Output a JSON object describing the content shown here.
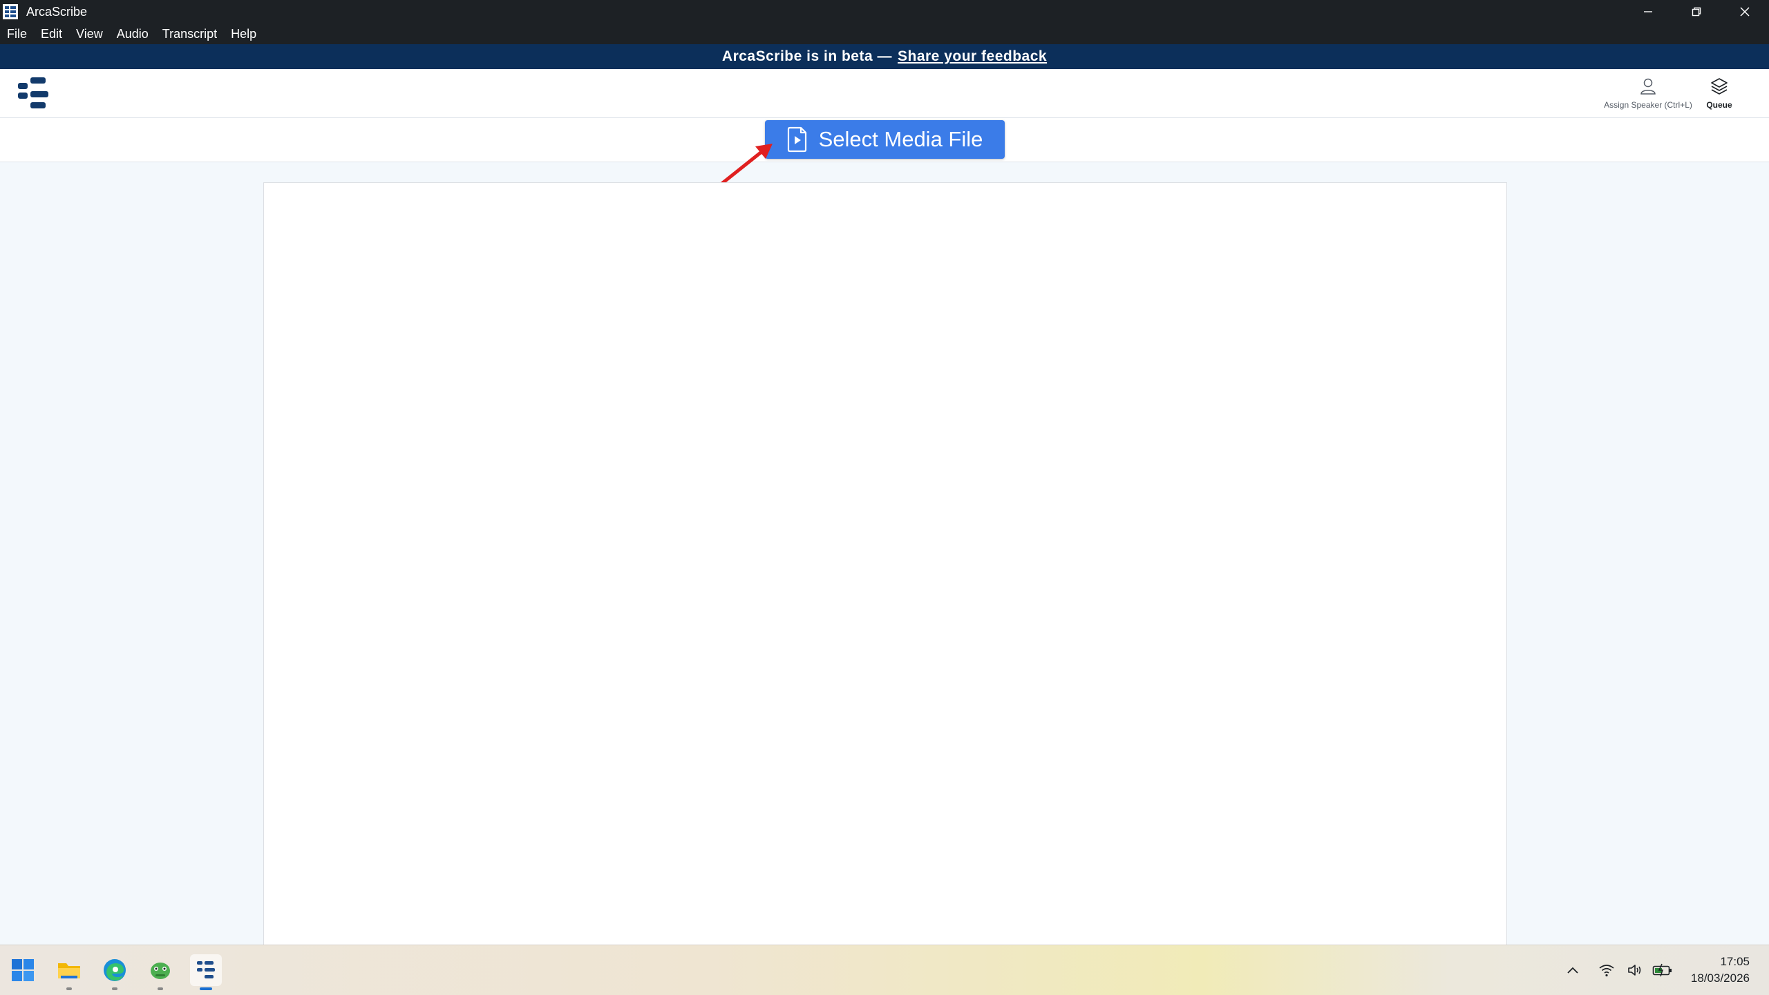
{
  "window": {
    "title": "ArcaScribe"
  },
  "menu": {
    "items": [
      "File",
      "Edit",
      "View",
      "Audio",
      "Transcript",
      "Help"
    ]
  },
  "banner": {
    "text": "ArcaScribe is in beta —",
    "link": "Share your feedback"
  },
  "header": {
    "assign_speaker_label": "Assign Speaker (Ctrl+L)",
    "queue_label": "Queue"
  },
  "toolbar": {
    "select_media_label": "Select Media File"
  },
  "taskbar": {
    "time": "17:05",
    "date": "18/03/2026"
  },
  "colors": {
    "accent": "#3b7ce8",
    "banner_bg": "#0c2f5a",
    "titlebar_bg": "#1d2125",
    "annotation_arrow": "#e02020"
  }
}
